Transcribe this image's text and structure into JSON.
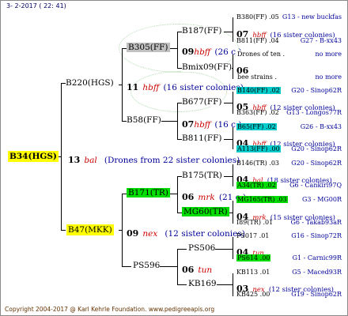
{
  "header": "3- 2-2017 ( 22: 41)",
  "footer": "Copyright 2004-2017 @ Karl Kehrle Foundation.    www.pedigreeapis.org",
  "root": {
    "name": "B34(HGS)",
    "gen": "13",
    "gen_code": "bal",
    "siblings": "(Drones from 22 sister colonies)"
  },
  "g1": {
    "top": {
      "name": "B220(HGS)",
      "gen": "11",
      "gen_code": "hbff",
      "siblings": "(16 sister colonies)"
    },
    "bottom": {
      "name": "B47(MKK)",
      "gen": "09",
      "gen_code": "nex",
      "siblings": "(12 sister colonies)"
    }
  },
  "g2": {
    "a": {
      "name": "B305(FF)",
      "gen": "09",
      "gen_code": "hbff",
      "siblings": "(26 c.)"
    },
    "b": {
      "name": "B58(FF)",
      "gen": "07",
      "gen_code": "hbff",
      "siblings": "(16 c.)"
    },
    "c": {
      "name": "B171(TR)",
      "gen": "06",
      "gen_code": "mrk",
      "siblings": "(21 c.)"
    },
    "d": {
      "name": "PS596",
      "gen": "06",
      "gen_code": "tun",
      "siblings": ""
    }
  },
  "g3": {
    "a": "B187(FF)",
    "b": "Bmix09(FF)",
    "c": "B677(FF)",
    "d": "B811(FF)",
    "e": "B175(TR)",
    "f": "MG60(TR)",
    "g": "PS506",
    "h": "KB169"
  },
  "g3_gen": {
    "b": "06",
    "c": {
      "gen": "05",
      "code": "hbff",
      "sib": "(12 sister colonies)"
    },
    "d": {
      "gen": "04",
      "code": "hbff",
      "sib": "(12 sister colonies)"
    },
    "e": {
      "gen": "04",
      "code": "bal",
      "sib": "(18 sister colonies)"
    },
    "f": {
      "gen": "04",
      "code": "mrk",
      "sib": "(15 sister colonies)"
    },
    "g": {
      "gen": "04",
      "code": "tun",
      "sib": ""
    },
    "h": {
      "gen": "03",
      "code": "nex",
      "sib": "(12 sister colonies)"
    },
    "a": {
      "gen": "07",
      "code": "hbff",
      "sib": "(16 sister colonies)"
    }
  },
  "g4": [
    {
      "left": "B380(FF) .05",
      "right": "G13 - new buckfas"
    },
    {
      "left": "B811(FF) .04",
      "right": "G27 - B-xx43"
    },
    {
      "left": "Drones of ten .",
      "right": "no more"
    },
    {
      "left": "bee strains .",
      "right": "no more"
    },
    {
      "left": "B140(FF) .02",
      "right": "G20 - Sinop62R"
    },
    {
      "left": "B363(FF) .02",
      "right": "G13 - Longos77R"
    },
    {
      "left": "B65(FF) .02",
      "right": "G26 - B-xx43"
    },
    {
      "left": "A113(FF) .00",
      "right": "G20 - Sinop62R"
    },
    {
      "left": "B146(TR) .03",
      "right": "G20 - Sinop62R"
    },
    {
      "left": "A34(TR) .02",
      "right": "G6 - Cankiri97Q"
    },
    {
      "left": "MG165(TR) .03",
      "right": "G3 - MG00R"
    },
    {
      "left": "I89(TR) .01",
      "right": "G6 - Takab93aR"
    },
    {
      "left": "PS017 .01",
      "right": "G16 - Sinop72R"
    },
    {
      "left": "PS614 .00",
      "right": "G1 - Carnic99R"
    },
    {
      "left": "KB113 .01",
      "right": "G5 - Maced93R"
    },
    {
      "left": "KB425 .00",
      "right": "G19 - Sinop62R"
    }
  ]
}
